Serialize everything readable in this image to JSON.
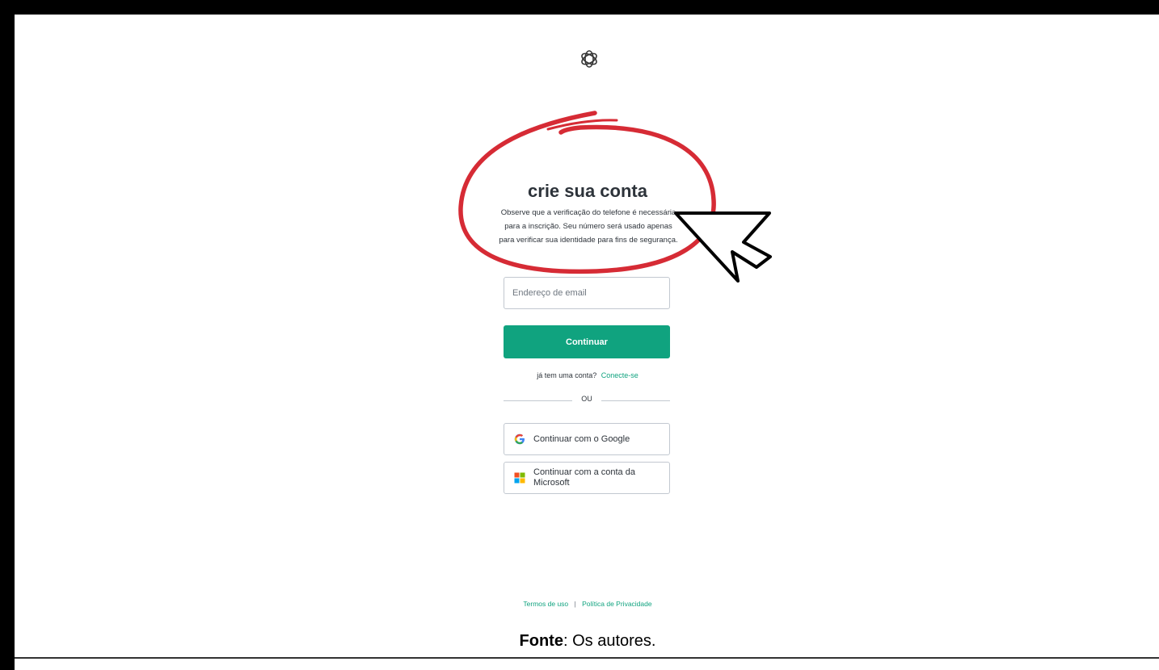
{
  "header": {
    "logo_icon": "openai-logo-icon"
  },
  "signup": {
    "title": "crie sua conta",
    "subtitle": "Observe que a verificação do telefone é necessária para a inscrição. Seu número será usado apenas para verificar sua identidade para fins de segurança.",
    "email_placeholder": "Endereço de email",
    "continue_label": "Continuar",
    "have_account": "já tem uma conta?",
    "login_link": "Conecte-se",
    "divider": "OU",
    "google_label": "Continuar com o Google",
    "microsoft_label": "Continuar com a conta da Microsoft"
  },
  "footer": {
    "terms": "Termos de uso",
    "separator": "|",
    "privacy": "Política de Privacidade"
  },
  "caption": {
    "label": "Fonte",
    "text": ": Os autores."
  },
  "colors": {
    "accent": "#10a37f",
    "annotation": "#d62b35",
    "text": "#2d333a",
    "border": "#c2c8d0"
  }
}
